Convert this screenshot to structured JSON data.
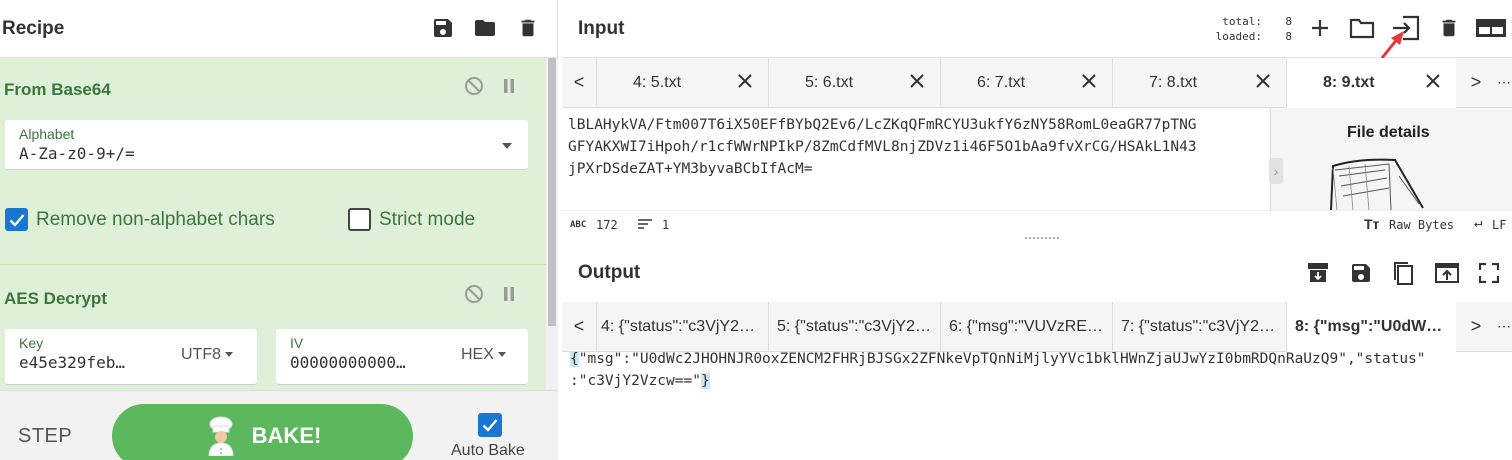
{
  "recipe": {
    "title": "Recipe",
    "toolbar_icons": [
      "save-icon",
      "folder-icon",
      "trash-icon"
    ],
    "operations": [
      {
        "name": "From Base64",
        "alphabet_label": "Alphabet",
        "alphabet_value": "A-Za-z0-9+/=",
        "remove_non_alpha_label": "Remove non-alphabet chars",
        "remove_non_alpha_checked": true,
        "strict_mode_label": "Strict mode",
        "strict_mode_checked": false
      },
      {
        "name": "AES Decrypt",
        "key_label": "Key",
        "key_value": "e45e329feb…",
        "key_encoding": "UTF8",
        "iv_label": "IV",
        "iv_value": "00000000000…",
        "iv_encoding": "HEX"
      }
    ]
  },
  "controls": {
    "step_label": "STEP",
    "bake_label": "BAKE!",
    "auto_bake_label": "Auto Bake",
    "auto_bake_checked": true
  },
  "input": {
    "title": "Input",
    "stats": {
      "total_label": "total:",
      "total_value": "8",
      "loaded_label": "loaded:",
      "loaded_value": "8"
    },
    "tabs": [
      "4: 5.txt",
      "5: 6.txt",
      "6: 7.txt",
      "7: 8.txt",
      "8: 9.txt"
    ],
    "active_tab": "8: 9.txt",
    "lines": [
      "lBLAHykVA/Ftm007T6iX50EFfBYbQ2Ev6/LcZKqQFmRCYU3ukfY6zNY58RomL0eaGR77pTNG",
      "GFYAKXWI7iHpoh/r1cfWWrNPIkP/8ZmCdfMVL8njZDVz1i46F5O1bAa9fvXrCG/HSAkL1N43",
      "jPXrDSdeZAT+YM3byvaBCbIfAcM="
    ],
    "file_details_title": "File details",
    "status": {
      "chars": "172",
      "lines": "1",
      "raw_bytes": "Raw Bytes",
      "eol": "LF"
    }
  },
  "output": {
    "title": "Output",
    "tabs": [
      "4: {\"status\":\"c3VjY2…",
      "5: {\"status\":\"c3VjY2…",
      "6: {\"msg\":\"VUVzRE…",
      "7: {\"status\":\"c3VjY2…",
      "8: {\"msg\":\"U0dW…"
    ],
    "active_tab": "8: {\"msg\":\"U0dW…",
    "line1_open": "{",
    "line1": "\"msg\":\"U0dWc2JHOHNJR0oxZENCM2FHRjBJSGx2ZFNkeVpTQnNiMjlyYVc1bklHWnZjaUJwYzI0bmRDQnRaUzQ9\",\"status\"",
    "line2": ":\"c3VjY2Vzcw==\"",
    "line2_close": "}"
  },
  "colors": {
    "recipe_bg": "#dff0d8",
    "op_title": "#3c763d",
    "bake": "#5cb85c",
    "checkbox": "#1976d2",
    "annotation_arrow": "#e53935"
  }
}
